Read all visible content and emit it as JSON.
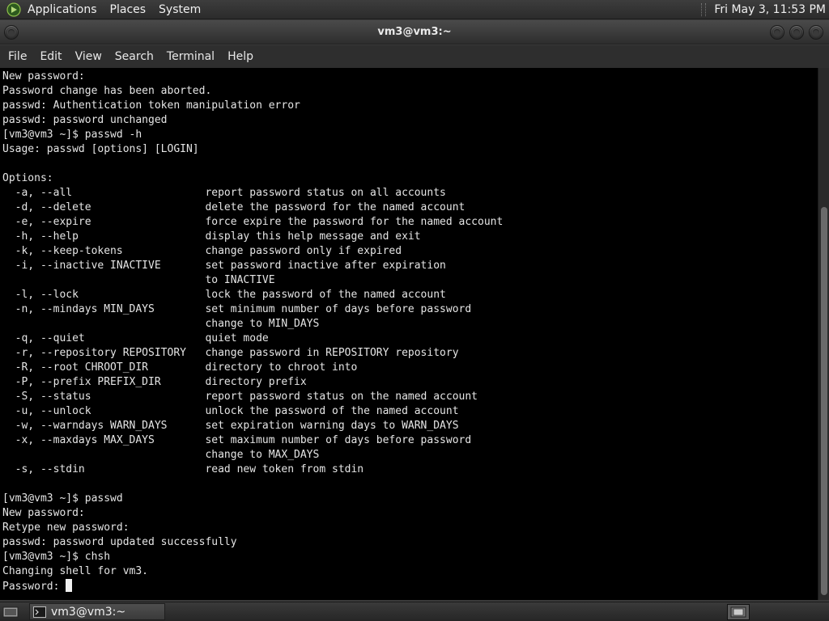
{
  "top_panel": {
    "menus": [
      "Applications",
      "Places",
      "System"
    ],
    "clock": "Fri May  3, 11:53 PM"
  },
  "window": {
    "title": "vm3@vm3:~",
    "menus": [
      "File",
      "Edit",
      "View",
      "Search",
      "Terminal",
      "Help"
    ]
  },
  "terminal": {
    "lines": [
      "New password:",
      "Password change has been aborted.",
      "passwd: Authentication token manipulation error",
      "passwd: password unchanged",
      "[vm3@vm3 ~]$ passwd -h",
      "Usage: passwd [options] [LOGIN]",
      "",
      "Options:",
      "  -a, --all                     report password status on all accounts",
      "  -d, --delete                  delete the password for the named account",
      "  -e, --expire                  force expire the password for the named account",
      "  -h, --help                    display this help message and exit",
      "  -k, --keep-tokens             change password only if expired",
      "  -i, --inactive INACTIVE       set password inactive after expiration",
      "                                to INACTIVE",
      "  -l, --lock                    lock the password of the named account",
      "  -n, --mindays MIN_DAYS        set minimum number of days before password",
      "                                change to MIN_DAYS",
      "  -q, --quiet                   quiet mode",
      "  -r, --repository REPOSITORY   change password in REPOSITORY repository",
      "  -R, --root CHROOT_DIR         directory to chroot into",
      "  -P, --prefix PREFIX_DIR       directory prefix",
      "  -S, --status                  report password status on the named account",
      "  -u, --unlock                  unlock the password of the named account",
      "  -w, --warndays WARN_DAYS      set expiration warning days to WARN_DAYS",
      "  -x, --maxdays MAX_DAYS        set maximum number of days before password",
      "                                change to MAX_DAYS",
      "  -s, --stdin                   read new token from stdin",
      "",
      "[vm3@vm3 ~]$ passwd",
      "New password:",
      "Retype new password:",
      "passwd: password updated successfully",
      "[vm3@vm3 ~]$ chsh",
      "Changing shell for vm3."
    ],
    "prompt_line": "Password: "
  },
  "taskbar": {
    "task_label": "vm3@vm3:~"
  }
}
